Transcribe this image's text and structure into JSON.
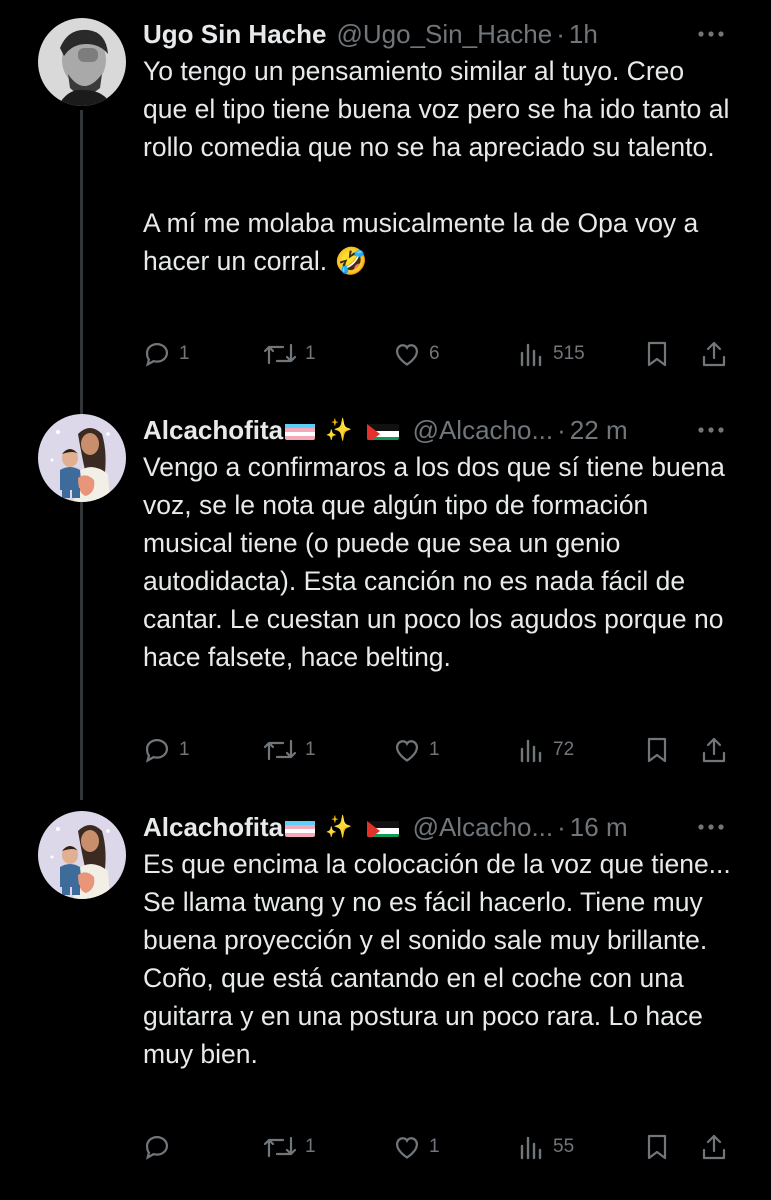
{
  "tweets": [
    {
      "name": "Ugo Sin Hache",
      "handle": "@Ugo_Sin_Hache",
      "time": "1h",
      "text": "Yo tengo un pensamiento similar al tuyo. Creo que el tipo tiene buena voz pero se ha ido tanto al rollo comedia que no se ha apreciado su talento.\n\nA mí me molaba musicalmente la de Opa voy a hacer un corral. 🤣",
      "replies": "1",
      "retweets": "1",
      "likes": "6",
      "views": "515"
    },
    {
      "name": "Alcachofita",
      "handle": "@Alcacho...",
      "time": "22 m",
      "text": "Vengo a confirmaros a los dos que sí tiene buena voz, se le nota que algún tipo de formación musical tiene (o puede que sea un genio autodidacta). Esta canción no es nada fácil de cantar. Le cuestan un poco los agudos porque no hace falsete, hace belting.",
      "replies": "1",
      "retweets": "1",
      "likes": "1",
      "views": "72"
    },
    {
      "name": "Alcachofita",
      "handle": "@Alcacho...",
      "time": "16 m",
      "text": "Es que encima la colocación de la voz que tiene... Se llama twang y no es fácil hacerlo. Tiene muy buena proyección y el sonido sale muy brillante. Coño, que está cantando en el coche con una guitarra y en una postura un poco rara. Lo hace muy bien.",
      "replies": "",
      "retweets": "1",
      "likes": "1",
      "views": "55"
    }
  ],
  "icons": {
    "reply": "reply-icon",
    "retweet": "retweet-icon",
    "like": "heart-icon",
    "views": "views-icon",
    "bookmark": "bookmark-icon",
    "share": "share-icon",
    "more": "more-icon"
  },
  "colors": {
    "background": "#000000",
    "text": "#e7e9ea",
    "muted": "#71767b"
  }
}
